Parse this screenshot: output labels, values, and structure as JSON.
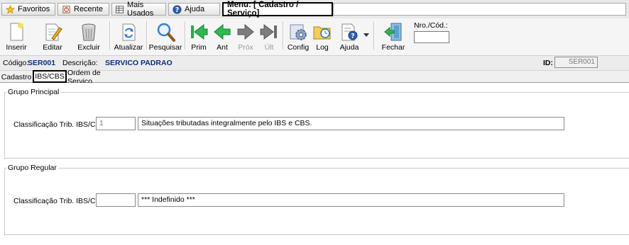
{
  "menubar": {
    "tabs": [
      {
        "label": "Favoritos",
        "icon": "star-icon"
      },
      {
        "label": "Recente",
        "icon": "recent-icon"
      },
      {
        "label": "Mais Usados",
        "icon": "table-icon"
      },
      {
        "label": "Ajuda",
        "icon": "help-icon"
      }
    ],
    "menu_label": "Menu: [ Cadastro / Serviço]"
  },
  "toolbar": {
    "inserir": "Inserir",
    "editar": "Editar",
    "excluir": "Excluir",
    "atualizar": "Atualizar",
    "pesquisar": "Pesquisar",
    "prim": "Prim",
    "ant": "Ant",
    "prox": "Próx",
    "ult": "Últ",
    "config": "Config",
    "log": "Log",
    "ajuda": "Ajuda",
    "fechar": "Fechar",
    "nro_label": "Nro./Cód.:",
    "nro_value": ""
  },
  "info": {
    "codigo_label": "Código:",
    "codigo_value": "SER001",
    "descricao_label": "Descrição:",
    "descricao_value": "SERVICO PADRAO",
    "id_label": "ID:",
    "id_value": "SER001"
  },
  "tabs": [
    "Cadastro",
    "IBS/CBS",
    "Ordem de Serviço"
  ],
  "active_tab": "IBS/CBS",
  "groups": {
    "principal": {
      "title": "Grupo Principal",
      "field_label": "Classificação Trib. IBS/CBS:",
      "code": "1",
      "description": "Situações tributadas integralmente pelo IBS e CBS."
    },
    "regular": {
      "title": "Grupo Regular",
      "field_label": "Classificação Trib. IBS/CBS:",
      "code": "",
      "description": "*** Indefinido ***"
    }
  }
}
